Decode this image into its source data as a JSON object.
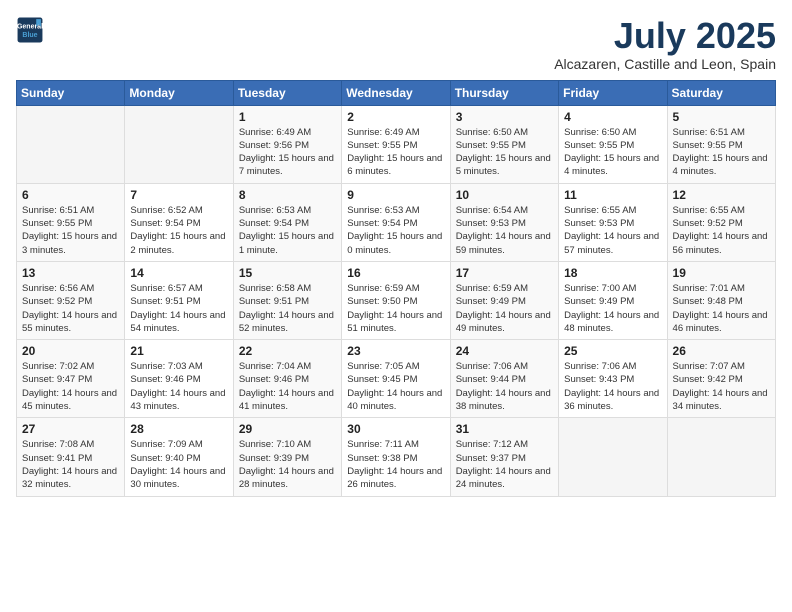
{
  "header": {
    "logo_line1": "General",
    "logo_line2": "Blue",
    "month": "July 2025",
    "location": "Alcazaren, Castille and Leon, Spain"
  },
  "weekdays": [
    "Sunday",
    "Monday",
    "Tuesday",
    "Wednesday",
    "Thursday",
    "Friday",
    "Saturday"
  ],
  "weeks": [
    [
      {
        "day": "",
        "info": ""
      },
      {
        "day": "",
        "info": ""
      },
      {
        "day": "1",
        "info": "Sunrise: 6:49 AM\nSunset: 9:56 PM\nDaylight: 15 hours and 7 minutes."
      },
      {
        "day": "2",
        "info": "Sunrise: 6:49 AM\nSunset: 9:55 PM\nDaylight: 15 hours and 6 minutes."
      },
      {
        "day": "3",
        "info": "Sunrise: 6:50 AM\nSunset: 9:55 PM\nDaylight: 15 hours and 5 minutes."
      },
      {
        "day": "4",
        "info": "Sunrise: 6:50 AM\nSunset: 9:55 PM\nDaylight: 15 hours and 4 minutes."
      },
      {
        "day": "5",
        "info": "Sunrise: 6:51 AM\nSunset: 9:55 PM\nDaylight: 15 hours and 4 minutes."
      }
    ],
    [
      {
        "day": "6",
        "info": "Sunrise: 6:51 AM\nSunset: 9:55 PM\nDaylight: 15 hours and 3 minutes."
      },
      {
        "day": "7",
        "info": "Sunrise: 6:52 AM\nSunset: 9:54 PM\nDaylight: 15 hours and 2 minutes."
      },
      {
        "day": "8",
        "info": "Sunrise: 6:53 AM\nSunset: 9:54 PM\nDaylight: 15 hours and 1 minute."
      },
      {
        "day": "9",
        "info": "Sunrise: 6:53 AM\nSunset: 9:54 PM\nDaylight: 15 hours and 0 minutes."
      },
      {
        "day": "10",
        "info": "Sunrise: 6:54 AM\nSunset: 9:53 PM\nDaylight: 14 hours and 59 minutes."
      },
      {
        "day": "11",
        "info": "Sunrise: 6:55 AM\nSunset: 9:53 PM\nDaylight: 14 hours and 57 minutes."
      },
      {
        "day": "12",
        "info": "Sunrise: 6:55 AM\nSunset: 9:52 PM\nDaylight: 14 hours and 56 minutes."
      }
    ],
    [
      {
        "day": "13",
        "info": "Sunrise: 6:56 AM\nSunset: 9:52 PM\nDaylight: 14 hours and 55 minutes."
      },
      {
        "day": "14",
        "info": "Sunrise: 6:57 AM\nSunset: 9:51 PM\nDaylight: 14 hours and 54 minutes."
      },
      {
        "day": "15",
        "info": "Sunrise: 6:58 AM\nSunset: 9:51 PM\nDaylight: 14 hours and 52 minutes."
      },
      {
        "day": "16",
        "info": "Sunrise: 6:59 AM\nSunset: 9:50 PM\nDaylight: 14 hours and 51 minutes."
      },
      {
        "day": "17",
        "info": "Sunrise: 6:59 AM\nSunset: 9:49 PM\nDaylight: 14 hours and 49 minutes."
      },
      {
        "day": "18",
        "info": "Sunrise: 7:00 AM\nSunset: 9:49 PM\nDaylight: 14 hours and 48 minutes."
      },
      {
        "day": "19",
        "info": "Sunrise: 7:01 AM\nSunset: 9:48 PM\nDaylight: 14 hours and 46 minutes."
      }
    ],
    [
      {
        "day": "20",
        "info": "Sunrise: 7:02 AM\nSunset: 9:47 PM\nDaylight: 14 hours and 45 minutes."
      },
      {
        "day": "21",
        "info": "Sunrise: 7:03 AM\nSunset: 9:46 PM\nDaylight: 14 hours and 43 minutes."
      },
      {
        "day": "22",
        "info": "Sunrise: 7:04 AM\nSunset: 9:46 PM\nDaylight: 14 hours and 41 minutes."
      },
      {
        "day": "23",
        "info": "Sunrise: 7:05 AM\nSunset: 9:45 PM\nDaylight: 14 hours and 40 minutes."
      },
      {
        "day": "24",
        "info": "Sunrise: 7:06 AM\nSunset: 9:44 PM\nDaylight: 14 hours and 38 minutes."
      },
      {
        "day": "25",
        "info": "Sunrise: 7:06 AM\nSunset: 9:43 PM\nDaylight: 14 hours and 36 minutes."
      },
      {
        "day": "26",
        "info": "Sunrise: 7:07 AM\nSunset: 9:42 PM\nDaylight: 14 hours and 34 minutes."
      }
    ],
    [
      {
        "day": "27",
        "info": "Sunrise: 7:08 AM\nSunset: 9:41 PM\nDaylight: 14 hours and 32 minutes."
      },
      {
        "day": "28",
        "info": "Sunrise: 7:09 AM\nSunset: 9:40 PM\nDaylight: 14 hours and 30 minutes."
      },
      {
        "day": "29",
        "info": "Sunrise: 7:10 AM\nSunset: 9:39 PM\nDaylight: 14 hours and 28 minutes."
      },
      {
        "day": "30",
        "info": "Sunrise: 7:11 AM\nSunset: 9:38 PM\nDaylight: 14 hours and 26 minutes."
      },
      {
        "day": "31",
        "info": "Sunrise: 7:12 AM\nSunset: 9:37 PM\nDaylight: 14 hours and 24 minutes."
      },
      {
        "day": "",
        "info": ""
      },
      {
        "day": "",
        "info": ""
      }
    ]
  ]
}
